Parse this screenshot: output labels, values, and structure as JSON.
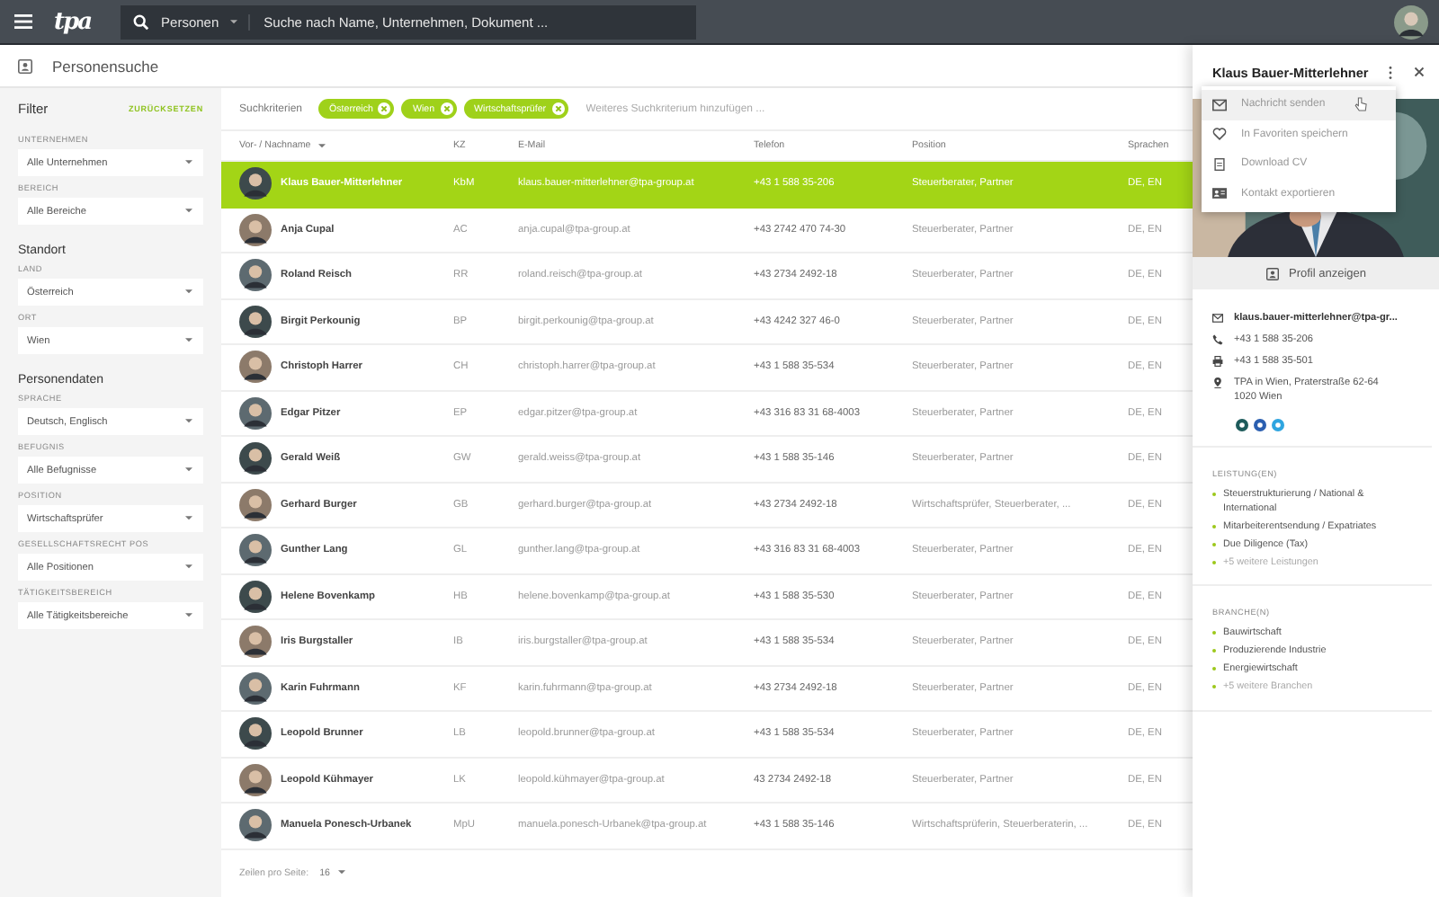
{
  "topbar": {
    "logo": "tpa",
    "search_scope": "Personen",
    "search": {
      "placeholder": "Suche nach Name, Unternehmen, Dokument ..."
    }
  },
  "page_title": "Personensuche",
  "filter": {
    "title": "Filter",
    "reset": "ZURÜCKSETZEN",
    "sections": [
      {
        "fields": [
          {
            "label": "UNTERNEHMEN",
            "value": "Alle Unternehmen"
          },
          {
            "label": "BEREICH",
            "value": "Alle Bereiche"
          }
        ]
      },
      {
        "heading": "Standort",
        "fields": [
          {
            "label": "LAND",
            "value": "Österreich"
          },
          {
            "label": "ORT",
            "value": "Wien"
          }
        ]
      },
      {
        "heading": "Personendaten",
        "fields": [
          {
            "label": "SPRACHE",
            "value": "Deutsch, Englisch"
          },
          {
            "label": "BEFUGNIS",
            "value": "Alle Befugnisse"
          },
          {
            "label": "POSITION",
            "value": "Wirtschaftsprüfer"
          },
          {
            "label": "GESELLSCHAFTSRECHT POS",
            "value": "Alle Positionen"
          },
          {
            "label": "TÄTIGKEITSBEREICH",
            "value": "Alle Tätigkeitsbereiche"
          }
        ]
      }
    ]
  },
  "criteria": {
    "label": "Suchkriterien",
    "chips": [
      "Österreich",
      "Wien",
      "Wirtschaftsprüfer"
    ],
    "placeholder": "Weiteres Suchkriterium hinzufügen ..."
  },
  "table": {
    "columns": [
      "Vor- / Nachname",
      "KZ",
      "E-Mail",
      "Telefon",
      "Position",
      "Sprachen"
    ],
    "rows": [
      {
        "name": "Klaus Bauer-Mitterlehner",
        "kz": "KbM",
        "email": "klaus.bauer-mitterlehner@tpa-group.at",
        "phone": "+43 1 588 35-206",
        "position": "Steuerberater, Partner",
        "languages": "DE, EN",
        "selected": true
      },
      {
        "name": "Anja Cupal",
        "kz": "AC",
        "email": "anja.cupal@tpa-group.at",
        "phone": "+43 2742 470 74-30",
        "position": "Steuerberater, Partner",
        "languages": "DE, EN",
        "selected": false
      },
      {
        "name": "Roland Reisch",
        "kz": "RR",
        "email": "roland.reisch@tpa-group.at",
        "phone": "+43 2734 2492-18",
        "position": "Steuerberater, Partner",
        "languages": "DE, EN",
        "selected": false
      },
      {
        "name": "Birgit Perkounig",
        "kz": "BP",
        "email": "birgit.perkounig@tpa-group.at",
        "phone": "+43 4242 327 46-0",
        "position": "Steuerberater, Partner",
        "languages": "DE, EN",
        "selected": false
      },
      {
        "name": "Christoph Harrer",
        "kz": "CH",
        "email": "christoph.harrer@tpa-group.at",
        "phone": "+43 1 588 35-534",
        "position": "Steuerberater, Partner",
        "languages": "DE, EN",
        "selected": false
      },
      {
        "name": "Edgar Pitzer",
        "kz": "EP",
        "email": "edgar.pitzer@tpa-group.at",
        "phone": "+43 316 83 31 68-4003",
        "position": "Steuerberater, Partner",
        "languages": "DE, EN",
        "selected": false
      },
      {
        "name": "Gerald Weiß",
        "kz": "GW",
        "email": "gerald.weiss@tpa-group.at",
        "phone": "+43 1 588 35-146",
        "position": "Steuerberater, Partner",
        "languages": "DE, EN",
        "selected": false
      },
      {
        "name": "Gerhard Burger",
        "kz": "GB",
        "email": "gerhard.burger@tpa-group.at",
        "phone": "+43 2734 2492-18",
        "position": "Wirtschaftsprüfer, Steuerberater, ...",
        "languages": "DE, EN",
        "selected": false
      },
      {
        "name": "Gunther Lang",
        "kz": "GL",
        "email": "gunther.lang@tpa-group.at",
        "phone": "+43 316 83 31 68-4003",
        "position": "Steuerberater, Partner",
        "languages": "DE, EN",
        "selected": false
      },
      {
        "name": "Helene Bovenkamp",
        "kz": "HB",
        "email": "helene.bovenkamp@tpa-group.at",
        "phone": "+43 1 588 35-530",
        "position": "Steuerberater, Partner",
        "languages": "DE, EN",
        "selected": false
      },
      {
        "name": "Iris Burgstaller",
        "kz": "IB",
        "email": "iris.burgstaller@tpa-group.at",
        "phone": "+43 1 588 35-534",
        "position": "Steuerberater, Partner",
        "languages": "DE, EN",
        "selected": false
      },
      {
        "name": "Karin Fuhrmann",
        "kz": "KF",
        "email": "karin.fuhrmann@tpa-group.at",
        "phone": "+43 2734 2492-18",
        "position": "Steuerberater, Partner",
        "languages": "DE, EN",
        "selected": false
      },
      {
        "name": "Leopold Brunner",
        "kz": "LB",
        "email": "leopold.brunner@tpa-group.at",
        "phone": "+43 1 588 35-534",
        "position": "Steuerberater, Partner",
        "languages": "DE, EN",
        "selected": false
      },
      {
        "name": "Leopold Kühmayer",
        "kz": "LK",
        "email": "leopold.kühmayer@tpa-group.at",
        "phone": "43 2734 2492-18",
        "position": "Steuerberater, Partner",
        "languages": "DE, EN",
        "selected": false
      },
      {
        "name": "Manuela Ponesch-Urbanek",
        "kz": "MpU",
        "email": "manuela.ponesch-Urbanek@tpa-group.at",
        "phone": "+43 1 588 35-146",
        "position": "Wirtschaftsprüferin, Steuerberaterin, ...",
        "languages": "DE, EN",
        "selected": false
      }
    ],
    "footer": {
      "label": "Zeilen pro Seite:",
      "value": "16"
    }
  },
  "detail": {
    "name": "Klaus Bauer-Mitterlehner",
    "menu": [
      {
        "label": "Nachricht senden",
        "hovered": true
      },
      {
        "label": "In Favoriten speichern",
        "hovered": false
      },
      {
        "label": "Download CV",
        "hovered": false
      },
      {
        "label": "Kontakt exportieren",
        "hovered": false
      }
    ],
    "profile_button": "Profil anzeigen",
    "contacts": [
      {
        "kind": "email",
        "lines": [
          "klaus.bauer-mitterlehner@tpa-gr..."
        ]
      },
      {
        "kind": "phone",
        "lines": [
          "+43 1 588 35-206"
        ]
      },
      {
        "kind": "fax",
        "lines": [
          "+43 1 588 35-501"
        ]
      },
      {
        "kind": "address",
        "lines": [
          "TPA in Wien, Praterstraße 62-64",
          "1020 Wien"
        ]
      }
    ],
    "socials": [
      {
        "color": "#1d5b5b"
      },
      {
        "color": "#2b5fb0"
      },
      {
        "color": "#2fa5e0"
      }
    ],
    "lists": [
      {
        "heading": "LEISTUNG(EN)",
        "items": [
          {
            "text": "Steuerstrukturierung / National & International",
            "kind": "item"
          },
          {
            "text": "Mitarbeiterentsendung / Expatriates",
            "kind": "item"
          },
          {
            "text": "Due Diligence (Tax)",
            "kind": "item"
          },
          {
            "text": "+5 weitere Leistungen",
            "kind": "more"
          }
        ]
      },
      {
        "heading": "BRANCHE(N)",
        "items": [
          {
            "text": "Bauwirtschaft",
            "kind": "item"
          },
          {
            "text": "Produzierende Industrie",
            "kind": "item"
          },
          {
            "text": "Energiewirtschaft",
            "kind": "item"
          },
          {
            "text": "+5 weitere Branchen",
            "kind": "more"
          }
        ]
      }
    ]
  }
}
